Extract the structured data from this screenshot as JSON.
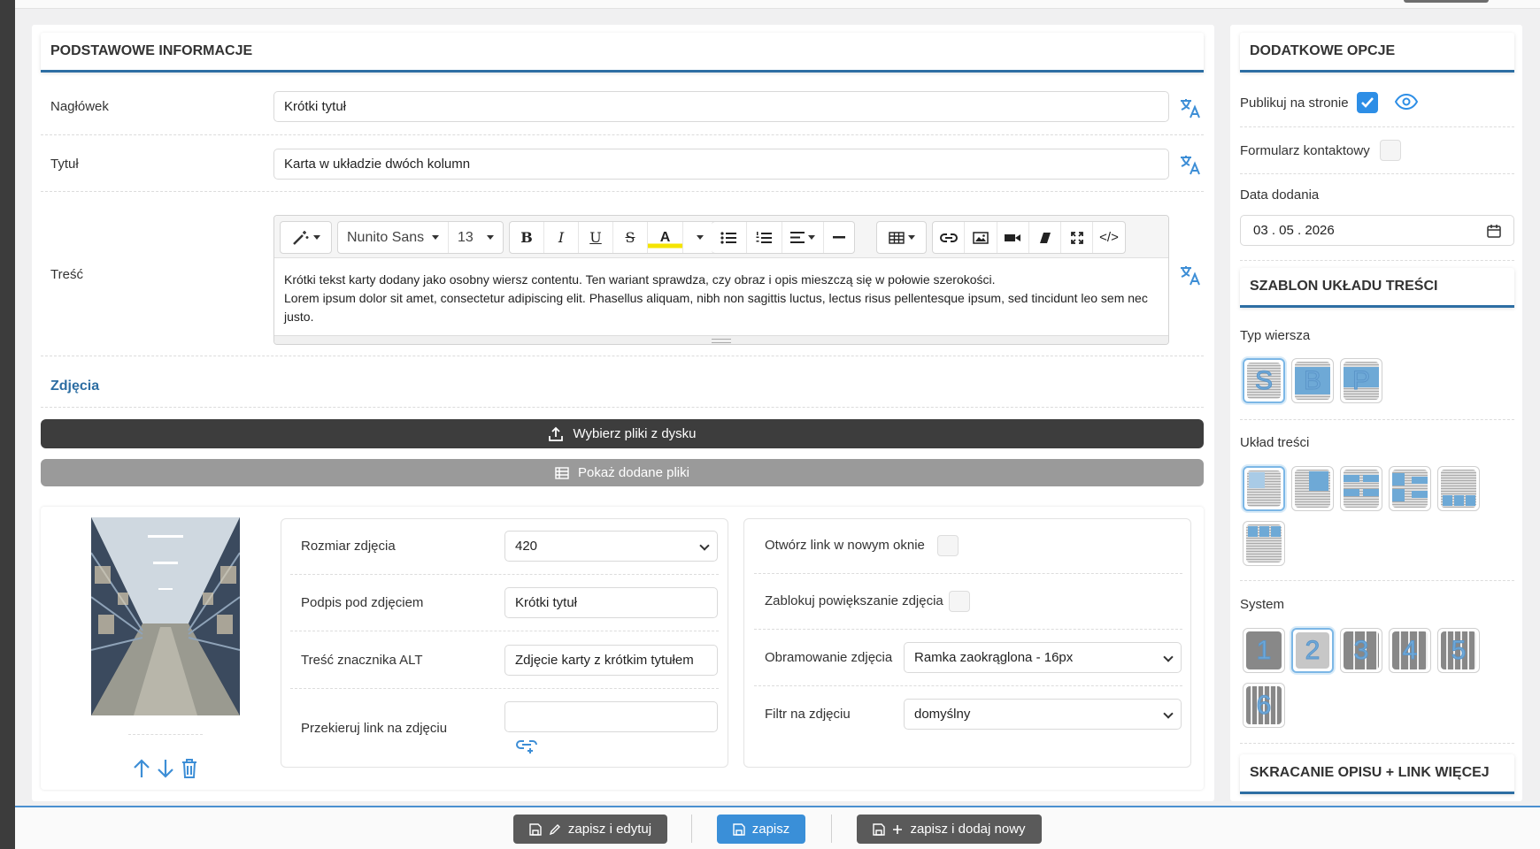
{
  "basic": {
    "header": "PODSTAWOWE INFORMACJE",
    "naglowek_label": "Nagłówek",
    "naglowek_value": "Krótki tytuł",
    "tytul_label": "Tytuł",
    "tytul_value": "Karta w układzie dwóch kolumn",
    "tresc_label": "Treść",
    "editor": {
      "font_family": "Nunito Sans",
      "font_size": "13",
      "code_label": "</>",
      "line1": "Krótki tekst karty dodany jako osobny wiersz contentu. Ten wariant sprawdza, czy obraz i opis mieszczą się w połowie szerokości.",
      "line2": "Lorem ipsum dolor sit amet, consectetur adipiscing elit. Phasellus aliquam, nibh non sagittis luctus, lectus risus pellentesque ipsum, sed tincidunt leo sem nec justo."
    },
    "zdjecia_label": "Zdjęcia",
    "upload_button": "Wybierz pliki z dysku",
    "show_files_button": "Pokaż dodane pliki"
  },
  "photo": {
    "size_label": "Rozmiar zdjęcia",
    "size_value": "420",
    "caption_label": "Podpis pod zdjęciem",
    "caption_value": "Krótki tytuł",
    "alt_label": "Treść znacznika ALT",
    "alt_value": "Zdjęcie karty z krótkim tytułem",
    "link_label": "Przekieruj link na zdjęciu",
    "link_value": "",
    "new_window_label": "Otwórz link w nowym oknie",
    "new_window_checked": false,
    "block_zoom_label": "Zablokuj powiększanie zdjęcia",
    "block_zoom_checked": false,
    "border_label": "Obramowanie zdjęcia",
    "border_value": "Ramka zaokrąglona - 16px",
    "filter_label": "Filtr na zdjęciu",
    "filter_value": "domyślny"
  },
  "options": {
    "header": "DODATKOWE OPCJE",
    "publish_label": "Publikuj na stronie",
    "publish_checked": true,
    "contact_label": "Formularz kontaktowy",
    "contact_checked": false,
    "date_label": "Data dodania",
    "date_value": "03 . 05 . 2026"
  },
  "template": {
    "header": "SZABLON UKŁADU TREŚCI",
    "row_type_label": "Typ wiersza",
    "row_types": [
      "S",
      "B",
      "P"
    ],
    "layout_label": "Układ treści",
    "system_label": "System",
    "systems": [
      "1",
      "2",
      "3",
      "4",
      "5",
      "6"
    ]
  },
  "shorten_header": "SKRACANIE OPISU + LINK WIĘCEJ",
  "footer": {
    "save_edit": "zapisz i edytuj",
    "save": "zapisz",
    "save_new": "zapisz i dodaj nowy"
  },
  "colors": {
    "accent": "#2d6ea3",
    "check": "#2d8ee6",
    "dark_bar": "#3d3d3d",
    "grey_bar": "#9a9a9a"
  }
}
